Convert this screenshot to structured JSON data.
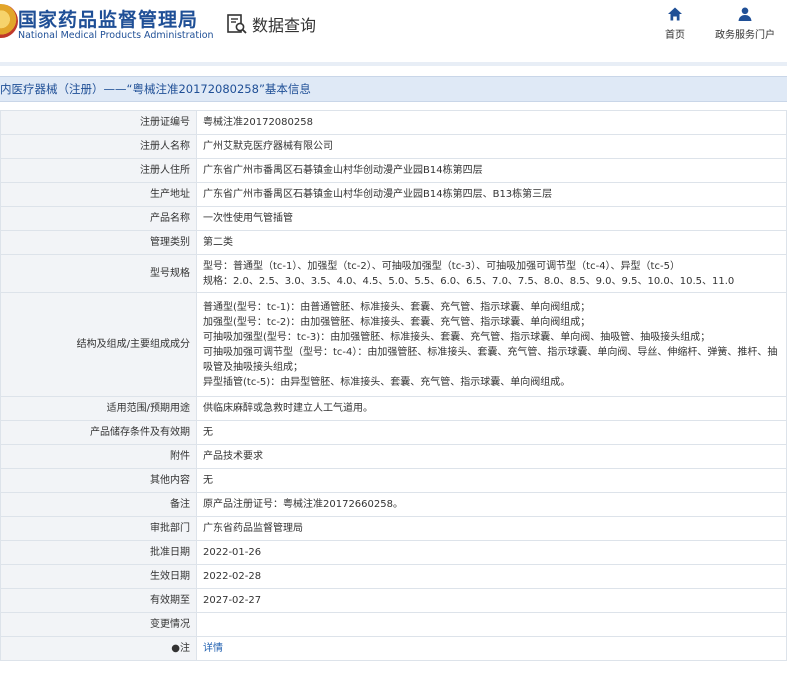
{
  "header": {
    "logo_cn": "国家药品监督管理局",
    "logo_en": "National Medical Products Administration",
    "query_label": "数据查询",
    "nav_home": "首页",
    "nav_gov": "政务服务门户"
  },
  "title": "内医疗器械（注册）——“粤械注准20172080258”基本信息",
  "rows": [
    {
      "key": "注册证编号",
      "value": "粤械注准20172080258"
    },
    {
      "key": "注册人名称",
      "value": "广州艾默克医疗器械有限公司"
    },
    {
      "key": "注册人住所",
      "value": "广东省广州市番禺区石碁镇金山村华创动漫产业园B14栋第四层"
    },
    {
      "key": "生产地址",
      "value": "广东省广州市番禺区石碁镇金山村华创动漫产业园B14栋第四层、B13栋第三层"
    },
    {
      "key": "产品名称",
      "value": "一次性使用气管插管"
    },
    {
      "key": "管理类别",
      "value": "第二类"
    },
    {
      "key": "型号规格",
      "lines": [
        "型号：普通型（tc-1）、加强型（tc-2）、可抽吸加强型（tc-3）、可抽吸加强可调节型（tc-4）、异型（tc-5）",
        "规格：2.0、2.5、3.0、3.5、4.0、4.5、5.0、5.5、6.0、6.5、7.0、7.5、8.0、8.5、9.0、9.5、10.0、10.5、11.0"
      ]
    },
    {
      "key": "结构及组成/主要组成成分",
      "lines": [
        "普通型(型号：tc-1)：由普通管胚、标准接头、套囊、充气管、指示球囊、单向阀组成；",
        "加强型(型号：tc-2)：由加强管胚、标准接头、套囊、充气管、指示球囊、单向阀组成；",
        "可抽吸加强型(型号：tc-3)：由加强管胚、标准接头、套囊、充气管、指示球囊、单向阀、抽吸管、抽吸接头组成；",
        "可抽吸加强可调节型（型号：tc-4）：由加强管胚、标准接头、套囊、充气管、指示球囊、单向阀、导丝、伸缩杆、弹簧、推杆、抽吸管及抽吸接头组成；",
        "异型插管(tc-5)：由异型管胚、标准接头、套囊、充气管、指示球囊、单向阀组成。"
      ]
    },
    {
      "key": "适用范围/预期用途",
      "value": "供临床麻醉或急救时建立人工气道用。"
    },
    {
      "key": "产品储存条件及有效期",
      "value": "无"
    },
    {
      "key": "附件",
      "value": "产品技术要求"
    },
    {
      "key": "其他内容",
      "value": "无"
    },
    {
      "key": "备注",
      "value": "原产品注册证号：粤械注准20172660258。"
    },
    {
      "key": "审批部门",
      "value": "广东省药品监督管理局"
    },
    {
      "key": "批准日期",
      "value": "2022-01-26"
    },
    {
      "key": "生效日期",
      "value": "2022-02-28"
    },
    {
      "key": "有效期至",
      "value": "2027-02-27"
    },
    {
      "key": "变更情况",
      "value": ""
    },
    {
      "key": "●注",
      "value": "详情",
      "link": true
    }
  ]
}
